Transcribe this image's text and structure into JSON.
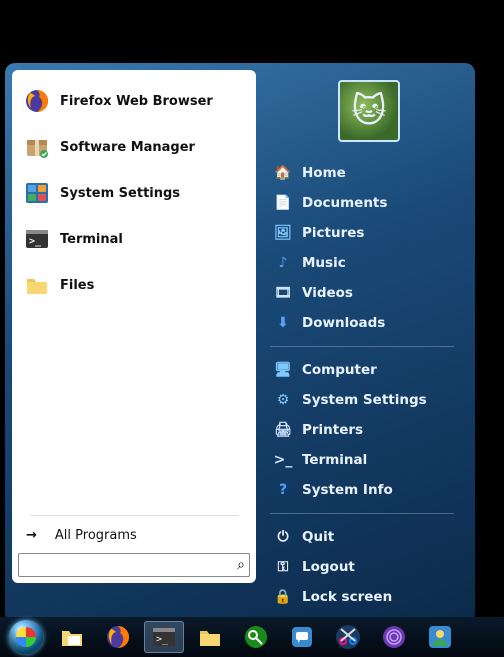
{
  "left_apps": [
    {
      "id": "firefox",
      "label": "Firefox Web Browser",
      "icon": "firefox-icon"
    },
    {
      "id": "software",
      "label": "Software Manager",
      "icon": "package-icon"
    },
    {
      "id": "settings",
      "label": "System Settings",
      "icon": "settings-panel-icon"
    },
    {
      "id": "terminal",
      "label": "Terminal",
      "icon": "terminal-icon"
    },
    {
      "id": "files",
      "label": "Files",
      "icon": "folder-icon"
    }
  ],
  "all_programs_label": "All Programs",
  "search": {
    "value": "",
    "placeholder": ""
  },
  "right_groups": [
    [
      {
        "id": "home",
        "label": "Home",
        "icon": "home-icon",
        "glyph": "🏠",
        "color": "#9fe07a"
      },
      {
        "id": "documents",
        "label": "Documents",
        "icon": "document-icon",
        "glyph": "📄",
        "color": "#cfe5ff"
      },
      {
        "id": "pictures",
        "label": "Pictures",
        "icon": "picture-icon",
        "glyph": "🖼",
        "color": "#7fc8ff"
      },
      {
        "id": "music",
        "label": "Music",
        "icon": "music-icon",
        "glyph": "♪",
        "color": "#5aa0ff"
      },
      {
        "id": "videos",
        "label": "Videos",
        "icon": "video-icon",
        "glyph": "🎞",
        "color": "#cfe5ff"
      },
      {
        "id": "downloads",
        "label": "Downloads",
        "icon": "download-icon",
        "glyph": "⬇",
        "color": "#5aa0ff"
      }
    ],
    [
      {
        "id": "computer",
        "label": "Computer",
        "icon": "computer-icon",
        "glyph": "🖥",
        "color": "#7fc8ff"
      },
      {
        "id": "system-settings",
        "label": "System Settings",
        "icon": "settings-icon",
        "glyph": "⚙",
        "color": "#7fc8ff"
      },
      {
        "id": "printers",
        "label": "Printers",
        "icon": "printer-icon",
        "glyph": "🖨",
        "color": "#cfe5ff"
      },
      {
        "id": "terminal2",
        "label": "Terminal",
        "icon": "terminal-icon",
        "glyph": ">_",
        "color": "#cfe5ff"
      },
      {
        "id": "system-info",
        "label": "System Info",
        "icon": "info-icon",
        "glyph": "?",
        "color": "#4aa3ff"
      }
    ],
    [
      {
        "id": "quit",
        "label": "Quit",
        "icon": "power-icon",
        "glyph": "⏻",
        "color": "#e9f3ff"
      },
      {
        "id": "logout",
        "label": "Logout",
        "icon": "key-icon",
        "glyph": "⚿",
        "color": "#e9f3ff"
      },
      {
        "id": "lock",
        "label": "Lock screen",
        "icon": "lock-icon",
        "glyph": "🔒",
        "color": "#7fc8ff"
      }
    ]
  ],
  "taskbar": [
    {
      "id": "start",
      "icon": "start-orb-icon",
      "active": false
    },
    {
      "id": "files-tb",
      "icon": "file-manager-icon",
      "active": false
    },
    {
      "id": "firefox-tb",
      "icon": "firefox-icon",
      "active": false
    },
    {
      "id": "terminal-tb",
      "icon": "terminal-icon",
      "active": true
    },
    {
      "id": "folder-tb",
      "icon": "folder-icon",
      "active": false
    },
    {
      "id": "keepass",
      "icon": "keepass-icon",
      "active": false
    },
    {
      "id": "chat",
      "icon": "chat-icon",
      "active": false
    },
    {
      "id": "snip",
      "icon": "snip-icon",
      "active": false
    },
    {
      "id": "tor",
      "icon": "tor-icon",
      "active": false
    },
    {
      "id": "user",
      "icon": "user-icon",
      "active": false
    }
  ]
}
